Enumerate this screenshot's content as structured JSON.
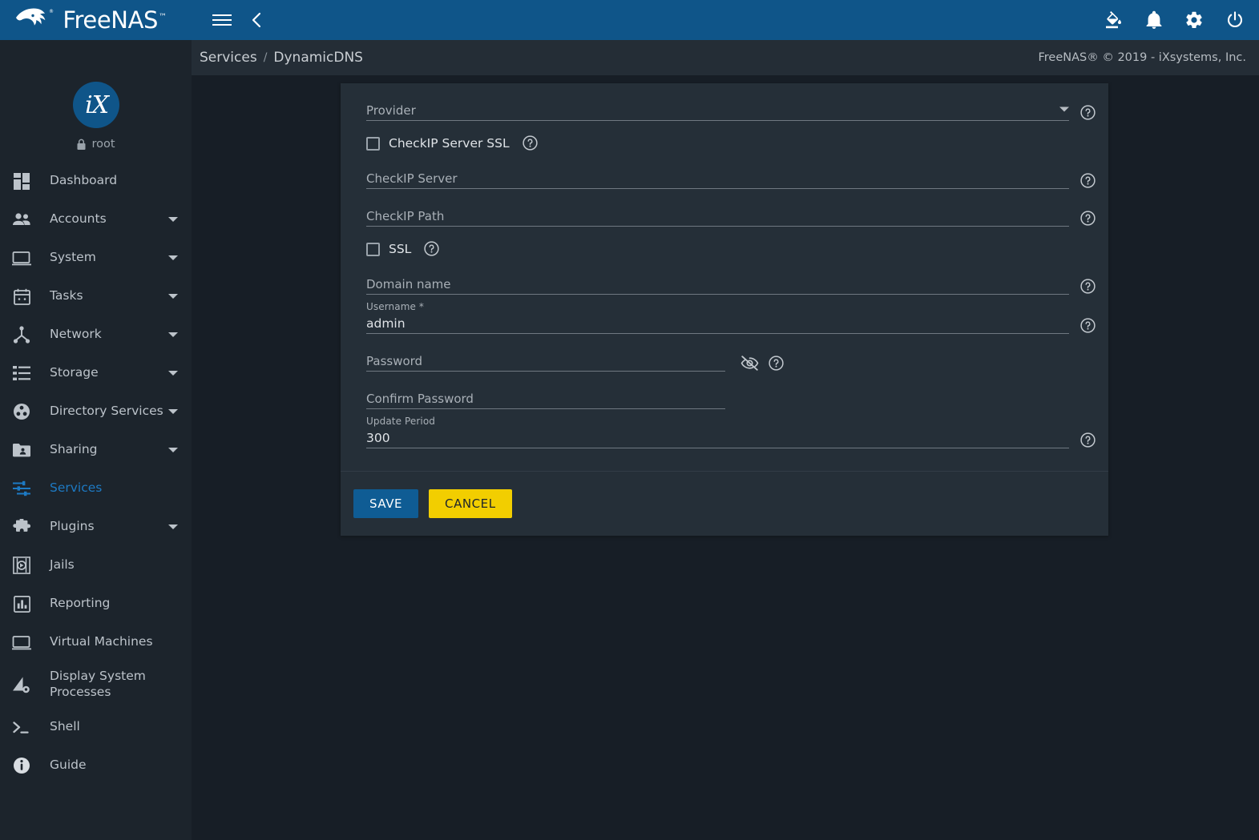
{
  "app": {
    "brand_name": "FreeNAS",
    "brand_tm": "™",
    "copyright": "FreeNAS® © 2019 - iXsystems, Inc."
  },
  "topbar": {
    "menu_icon": "hamburger-icon",
    "back_icon": "chevron-left-icon",
    "icons": [
      {
        "name": "theme-fill-icon",
        "label": "Change Theme"
      },
      {
        "name": "notifications-bell-icon",
        "label": "Alerts"
      },
      {
        "name": "settings-gear-icon",
        "label": "Settings"
      },
      {
        "name": "power-icon",
        "label": "Power"
      }
    ]
  },
  "breadcrumb": {
    "parent": "Services",
    "separator": "/",
    "current": "DynamicDNS"
  },
  "sidebar": {
    "avatar_text": "iX",
    "user": "root",
    "user_icon": "lock-icon",
    "items": [
      {
        "label": "Dashboard",
        "icon": "dashboard-icon",
        "expandable": false,
        "active": false
      },
      {
        "label": "Accounts",
        "icon": "people-icon",
        "expandable": true,
        "active": false
      },
      {
        "label": "System",
        "icon": "monitor-icon",
        "expandable": true,
        "active": false
      },
      {
        "label": "Tasks",
        "icon": "calendar-icon",
        "expandable": true,
        "active": false
      },
      {
        "label": "Network",
        "icon": "network-icon",
        "expandable": true,
        "active": false
      },
      {
        "label": "Storage",
        "icon": "storage-list-icon",
        "expandable": true,
        "active": false
      },
      {
        "label": "Directory Services",
        "icon": "directory-services-icon",
        "expandable": true,
        "active": false
      },
      {
        "label": "Sharing",
        "icon": "folder-share-icon",
        "expandable": true,
        "active": false
      },
      {
        "label": "Services",
        "icon": "sliders-icon",
        "expandable": false,
        "active": true
      },
      {
        "label": "Plugins",
        "icon": "puzzle-icon",
        "expandable": true,
        "active": false
      },
      {
        "label": "Jails",
        "icon": "jail-icon",
        "expandable": false,
        "active": false
      },
      {
        "label": "Reporting",
        "icon": "bar-chart-icon",
        "expandable": false,
        "active": false
      },
      {
        "label": "Virtual Machines",
        "icon": "monitor-icon",
        "expandable": false,
        "active": false
      },
      {
        "label": "Display System Processes",
        "icon": "process-icon",
        "expandable": false,
        "active": false
      },
      {
        "label": "Shell",
        "icon": "terminal-icon",
        "expandable": false,
        "active": false
      },
      {
        "label": "Guide",
        "icon": "info-icon",
        "expandable": false,
        "active": false
      }
    ]
  },
  "form": {
    "provider": {
      "label": "Provider",
      "value": "",
      "help_icon": "help-circle-icon",
      "dropdown_icon": "chevron-down-icon"
    },
    "checkip_server_ssl": {
      "label": "CheckIP Server SSL",
      "checked": false,
      "help_icon": "help-circle-icon"
    },
    "checkip_server": {
      "label": "CheckIP Server",
      "value": "",
      "help_icon": "help-circle-icon"
    },
    "checkip_path": {
      "label": "CheckIP Path",
      "value": "",
      "help_icon": "help-circle-icon"
    },
    "ssl": {
      "label": "SSL",
      "checked": false,
      "help_icon": "help-circle-icon"
    },
    "domain_name": {
      "label": "Domain name",
      "value": "",
      "help_icon": "help-circle-icon"
    },
    "username": {
      "label": "Username *",
      "value": "admin",
      "help_icon": "help-circle-icon"
    },
    "password": {
      "label": "Password",
      "value": "",
      "toggle_icon": "eye-off-icon",
      "help_icon": "help-circle-icon"
    },
    "confirm_password": {
      "label": "Confirm Password",
      "value": ""
    },
    "update_period": {
      "label": "Update Period",
      "value": "300",
      "help_icon": "help-circle-icon"
    },
    "actions": {
      "save": "SAVE",
      "cancel": "CANCEL"
    }
  },
  "colors": {
    "header_blue": "#0f5589",
    "sidebar_bg": "#1c242c",
    "page_bg": "#171e26",
    "card_bg": "#252f38",
    "accent_blue": "#1d7ac4",
    "save_blue": "#0f5c94",
    "cancel_yellow": "#f2ce00"
  }
}
